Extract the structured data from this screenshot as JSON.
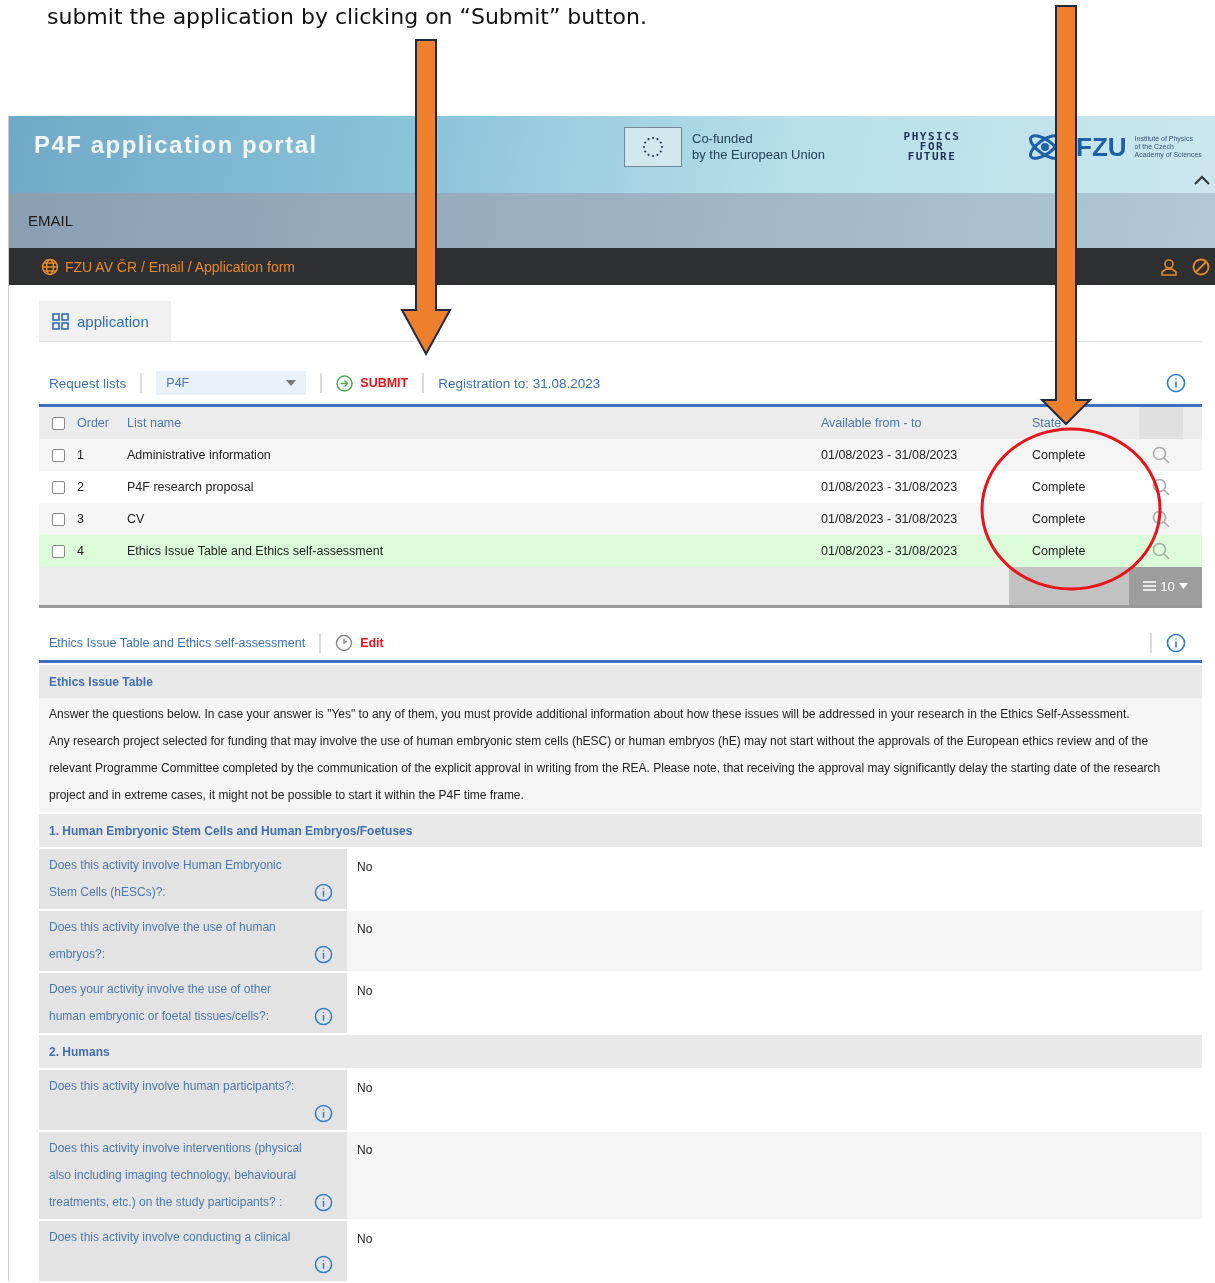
{
  "caption": "submit the application by clicking on “Submit” button.",
  "portal": {
    "title": "P4F application portal",
    "cofunded": [
      "Co-funded",
      "by the European Union"
    ],
    "physics_logo": [
      "PHYSICS",
      "FOR",
      "FUTURE"
    ],
    "fzu_logo": "FZU",
    "fzu_small": [
      "Institute of Physics",
      "of the Czech",
      "Academy of Sciences"
    ]
  },
  "section_label": "EMAIL",
  "breadcrumb": "FZU AV ČR / Email / Application form",
  "tabs": [
    {
      "label": "application",
      "selected": true
    }
  ],
  "toolbar": {
    "request_lists": "Request lists",
    "select_value": "P4F",
    "submit": "SUBMIT",
    "registration": "Registration to: 31.08.2023"
  },
  "table": {
    "select_all_checked": false,
    "columns": [
      "Order",
      "List name",
      "Available from - to",
      "State"
    ],
    "rows": [
      {
        "checked": false,
        "selected": false,
        "order": "1",
        "name": "Administrative information",
        "available": "01/08/2023 - 31/08/2023",
        "state": "Complete"
      },
      {
        "checked": false,
        "selected": false,
        "order": "2",
        "name": "P4F research proposal",
        "available": "01/08/2023 - 31/08/2023",
        "state": "Complete"
      },
      {
        "checked": false,
        "selected": false,
        "order": "3",
        "name": "CV",
        "available": "01/08/2023 - 31/08/2023",
        "state": "Complete"
      },
      {
        "checked": false,
        "selected": true,
        "order": "4",
        "name": "Ethics Issue Table and Ethics self-assessment",
        "available": "01/08/2023 - 31/08/2023",
        "state": "Complete"
      }
    ],
    "page_size": "10"
  },
  "detail": {
    "title": "Ethics Issue Table and Ethics self-assessment",
    "edit": "Edit",
    "heading": "Ethics Issue Table",
    "paragraphs": [
      "Answer the questions below. In case your answer is \"Yes\" to any of them, you must provide additional information about how these issues will be addressed in your research in the Ethics Self-Assessment.",
      "Any research project selected for funding that may involve the use of human embryonic stem cells (hESC) or human embryos (hE) may not start without the approvals of the European ethics review and of the relevant Programme Committee completed by the communication of the explicit approval in writing from the REA. Please note, that receiving the approval may significantly delay the starting date of the research project and in extreme cases, it might not be possible to start it within the P4F time frame."
    ],
    "groups": [
      {
        "title": "1. Human Embryonic Stem Cells and Human Embryos/Foetuses",
        "questions": [
          {
            "label": "Does this activity involve Human Embryonic Stem Cells (hESCs)?:",
            "answer": "No"
          },
          {
            "label": "Does this activity involve the use of human embryos?:",
            "answer": "No"
          },
          {
            "label": "Does your activity involve the use of other human embryonic or foetal tissues/cells?:",
            "answer": "No"
          }
        ]
      },
      {
        "title": "2. Humans",
        "questions": [
          {
            "label": "Does this activity involve human participants?:",
            "answer": "No"
          },
          {
            "label": "Does this activity involve interventions (physical also including imaging technology, behavioural treatments, etc.) on the study participants? :",
            "answer": "No"
          },
          {
            "label": "Does this activity involve conducting a clinical",
            "answer": "No"
          }
        ]
      }
    ]
  }
}
